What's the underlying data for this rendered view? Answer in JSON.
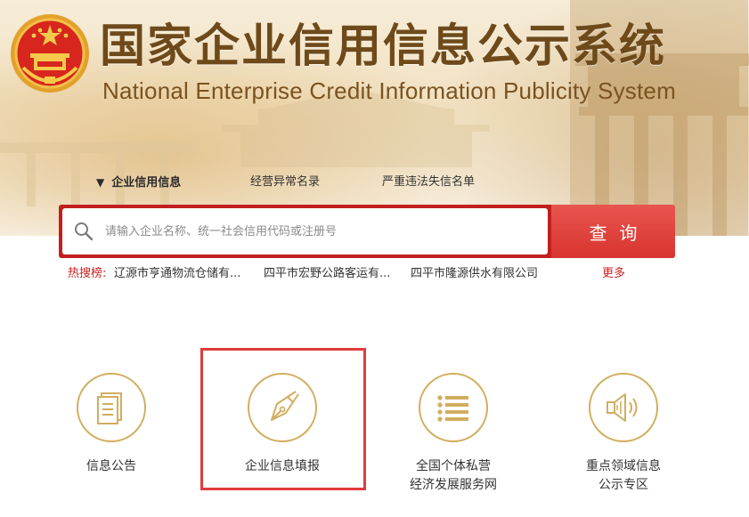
{
  "header": {
    "title_cn": "国家企业信用信息公示系统",
    "title_en": "National Enterprise Credit Information Publicity System",
    "emblem_icon": "national-emblem-icon"
  },
  "tabs": [
    {
      "label": "企业信用信息",
      "active": true,
      "arrow": "▼"
    },
    {
      "label": "经营异常名录",
      "active": false
    },
    {
      "label": "严重违法失信名单",
      "active": false
    }
  ],
  "search": {
    "placeholder": "请输入企业名称、统一社会信用代码或注册号",
    "value": "",
    "button_label": "查询",
    "icon": "search-icon"
  },
  "hot_search": {
    "label": "热搜榜:",
    "items": [
      "辽源市亨通物流仓储有...",
      "四平市宏野公路客运有...",
      "四平市隆源供水有限公司"
    ],
    "more_label": "更多"
  },
  "features": [
    {
      "label_lines": [
        "信息公告"
      ],
      "icon": "document-icon"
    },
    {
      "label_lines": [
        "企业信息填报"
      ],
      "icon": "pen-nib-icon",
      "highlighted": true
    },
    {
      "label_lines": [
        "全国个体私营",
        "经济发展服务网"
      ],
      "icon": "list-icon"
    },
    {
      "label_lines": [
        "重点领域信息",
        "公示专区"
      ],
      "icon": "speaker-icon"
    }
  ],
  "colors": {
    "brand_red": "#d9342f",
    "title_brown": "#6e4a1b",
    "feature_gold": "#d2ad5f",
    "highlight_red": "#e23c3c"
  }
}
